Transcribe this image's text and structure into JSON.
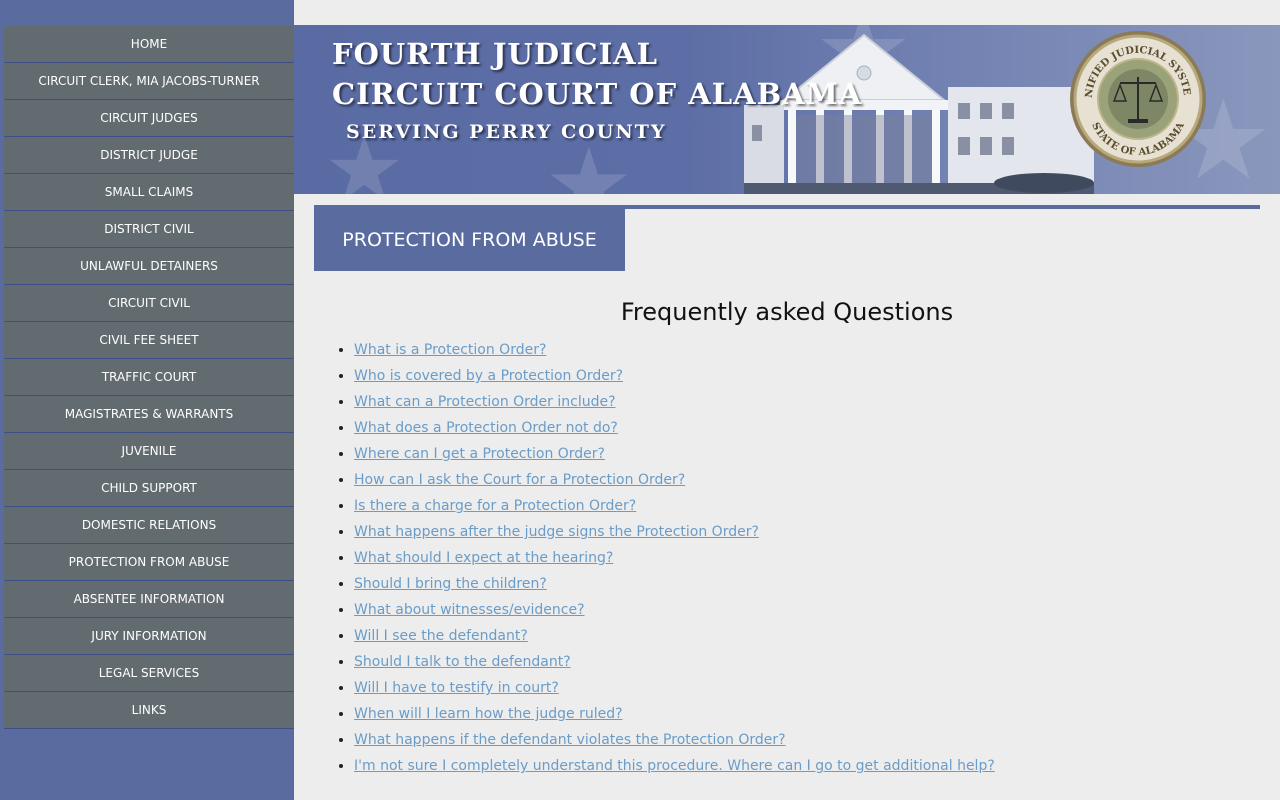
{
  "sidebar": {
    "items": [
      {
        "label": "HOME"
      },
      {
        "label": "CIRCUIT CLERK, MIA JACOBS-TURNER"
      },
      {
        "label": "CIRCUIT JUDGES"
      },
      {
        "label": "DISTRICT JUDGE"
      },
      {
        "label": "SMALL CLAIMS"
      },
      {
        "label": "DISTRICT CIVIL"
      },
      {
        "label": "UNLAWFUL DETAINERS"
      },
      {
        "label": "CIRCUIT CIVIL"
      },
      {
        "label": "CIVIL FEE SHEET"
      },
      {
        "label": "TRAFFIC COURT"
      },
      {
        "label": "MAGISTRATES & WARRANTS"
      },
      {
        "label": "JUVENILE"
      },
      {
        "label": "CHILD SUPPORT"
      },
      {
        "label": "DOMESTIC RELATIONS"
      },
      {
        "label": "PROTECTION FROM ABUSE"
      },
      {
        "label": "ABSENTEE INFORMATION"
      },
      {
        "label": "JURY INFORMATION"
      },
      {
        "label": "LEGAL SERVICES"
      },
      {
        "label": "LINKS"
      }
    ]
  },
  "banner": {
    "line1": "FOURTH  JUDICIAL",
    "line2": "CIRCUIT COURT OF ALABAMA",
    "line3": "SERVING  PERRY  COUNTY",
    "seal_top_text": "UNIFIED JUDICIAL SYSTEM",
    "seal_bottom_text": "STATE OF ALABAMA"
  },
  "page": {
    "title": "PROTECTION FROM ABUSE",
    "faq_heading": "Frequently asked Questions"
  },
  "faq": [
    "What is a Protection Order?",
    "Who is covered by a Protection Order?",
    "What can a Protection Order include?",
    "What does a Protection Order not do?",
    "Where can I get a Protection Order?",
    "How can I ask the Court for a Protection Order?",
    "Is there a charge for a Protection Order?",
    "What happens after the judge signs the Protection Order?",
    "What should I expect at the hearing?",
    "Should I bring the children?",
    "What about witnesses/evidence?",
    "Will I see the defendant?",
    "Should I talk to the defendant?",
    "Will I have to testify in court?",
    "When will I learn how the judge ruled?",
    "What happens if the defendant violates the Protection Order?",
    "I'm not sure I completely understand this procedure. Where can I go to get additional help?"
  ],
  "colors": {
    "brand_blue": "#5a6ba0",
    "nav_gray": "#626b70",
    "link": "#6a9cc8",
    "background": "#ededed"
  }
}
